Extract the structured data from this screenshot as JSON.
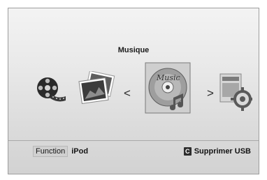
{
  "menu": {
    "selected_title": "Musique",
    "items": [
      {
        "icon": "film-reel-icon"
      },
      {
        "icon": "photos-icon"
      },
      {
        "icon": "music-cd-icon",
        "selected": true
      },
      {
        "icon": "settings-icon"
      }
    ],
    "nav_left": "<",
    "nav_right": ">"
  },
  "footer": {
    "function_label": "Function",
    "function_value": "iPod",
    "key_c": "C",
    "remove_usb": "Supprimer USB"
  },
  "cd_text": "Music"
}
